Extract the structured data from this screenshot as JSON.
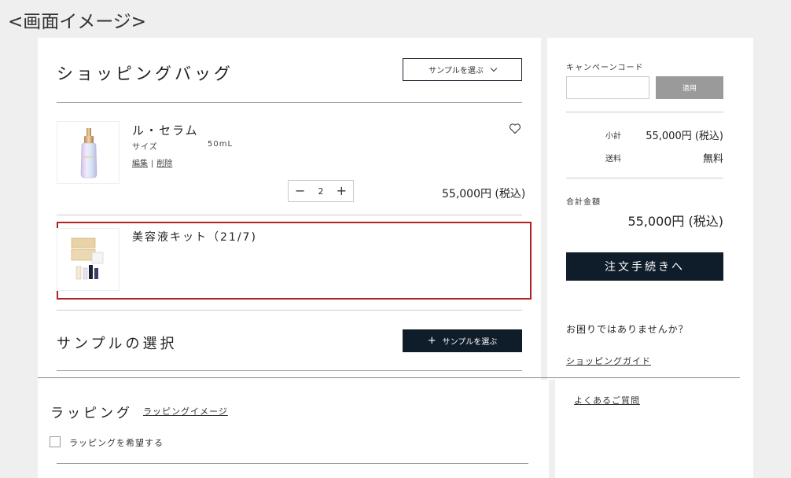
{
  "caption": "<画面イメージ>",
  "bag": {
    "title": "ショッピングバッグ",
    "select_sample_label": "サンプルを選ぶ"
  },
  "items": [
    {
      "name": "ル・セラム",
      "size_label": "サイズ",
      "size_value": "50mL",
      "edit_label": "編集",
      "delete_label": "削除",
      "quantity": "2",
      "price": "55,000円 (税込)"
    },
    {
      "name": "美容液キット（21/7)"
    }
  ],
  "samples": {
    "title": "サンプルの選択",
    "add_label": "サンプルを選ぶ"
  },
  "wrapping": {
    "title": "ラッピング",
    "image_link": "ラッピングイメージ",
    "checkbox_label": "ラッピングを希望する"
  },
  "summary": {
    "campaign_label": "キャンペーンコード",
    "campaign_value": "",
    "apply_label": "適用",
    "subtotal_label": "小計",
    "subtotal_value": "55,000円 (税込)",
    "shipping_label": "送料",
    "shipping_value": "無料",
    "total_label": "合計金額",
    "total_value": "55,000円 (税込)",
    "checkout_label": "注文手続きへ",
    "help_text": "お困りではありませんか？",
    "guide_link": "ショッピングガイド",
    "faq_link": "よくあるご質問"
  },
  "colors": {
    "navy": "#0f1c2a",
    "highlight_border": "#b22222",
    "apply_gray": "#9a9a9a"
  }
}
